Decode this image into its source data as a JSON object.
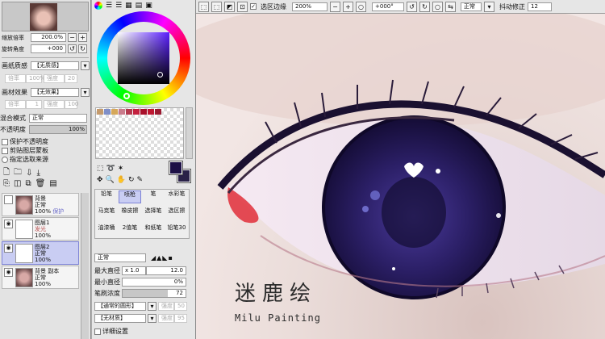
{
  "nav": {
    "zoom_label": "缩放倍率",
    "zoom_value": "200.0%",
    "rotate_label": "旋转角度",
    "rotate_value": "+000"
  },
  "paper": {
    "label": "画纸质感",
    "value": "【无质感】",
    "scale": "倍率",
    "scale_val": "100%",
    "strength": "强度",
    "strength_val": "20"
  },
  "effect": {
    "label": "画材效果",
    "value": "【无效果】",
    "scale": "倍率",
    "scale_val": "1",
    "strength": "强度",
    "strength_val": "100"
  },
  "blend": {
    "label": "混合模式",
    "value": "正常"
  },
  "opacity": {
    "label": "不透明度",
    "value": "100%"
  },
  "checks": {
    "protect": "保护不透明度",
    "clip": "剪贴图层蒙板",
    "selsrc": "指定选取来源"
  },
  "layers": [
    {
      "name": "背景",
      "mode": "正常",
      "opacity": "100%",
      "extra": "保护"
    },
    {
      "name": "图层1",
      "mode": "发光",
      "opacity": "100%",
      "extra": ""
    },
    {
      "name": "图层2",
      "mode": "正常",
      "opacity": "100%",
      "extra": ""
    },
    {
      "name": "背景 副本",
      "mode": "正常",
      "opacity": "100%",
      "extra": ""
    }
  ],
  "tools": [
    "铅笔",
    "喷枪",
    "笔",
    "水彩笔",
    "马克笔",
    "橡皮擦",
    "选择笔",
    "选区擦",
    "油漆桶",
    "2值笔",
    "和纸笔",
    "铅笔30"
  ],
  "brush": {
    "mode": "正常",
    "max_label": "最大直径",
    "max_mult": "x 1.0",
    "max_val": "12.0",
    "min_label": "最小直径",
    "min_val": "0%",
    "density_label": "笔刷浓度",
    "density_val": "72",
    "shape": "【通常的圆形】",
    "shape_strength": "强度",
    "shape_strength_val": "50",
    "texture": "【无材质】",
    "texture_strength": "强度",
    "texture_strength_val": "95",
    "detail": "详细设置"
  },
  "toolbar": {
    "selection_edge": "选区边缘",
    "zoom": "200%",
    "angle": "+000°",
    "mode": "正常",
    "stabilizer_label": "抖动修正",
    "stabilizer_val": "12"
  },
  "canvas": {
    "watermark_cn": "迷鹿绘",
    "watermark_en": "Milu Painting"
  },
  "colors": {
    "accent": "#6d70d8",
    "current_fg": "#1d1046",
    "current_bg": "#2a2148"
  }
}
